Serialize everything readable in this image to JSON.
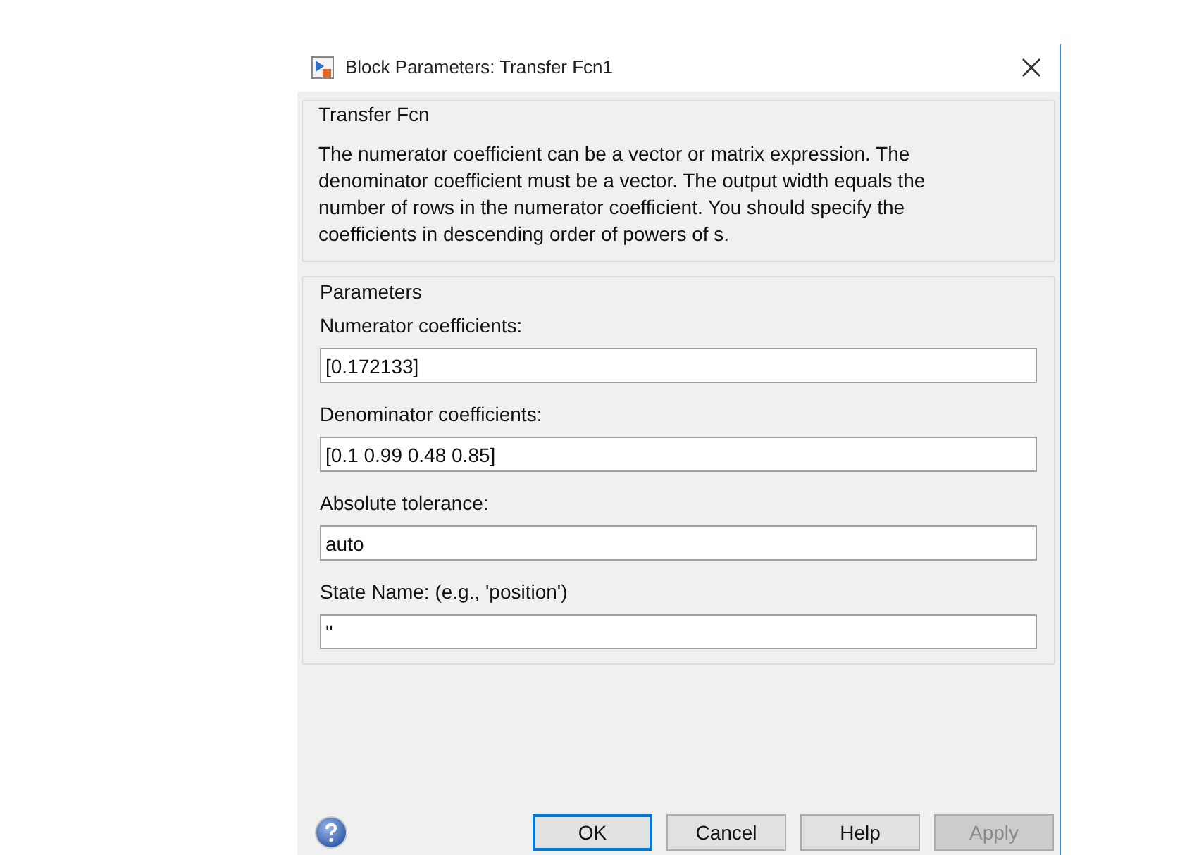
{
  "window": {
    "title": "Block Parameters: Transfer Fcn1"
  },
  "description_group": {
    "title": "Transfer Fcn",
    "text": "The numerator coefficient can be a vector or matrix expression. The denominator coefficient must be a vector. The output width equals the number of rows in the numerator coefficient. You should specify the coefficients in descending order of powers of s."
  },
  "parameters_group": {
    "title": "Parameters",
    "fields": [
      {
        "label": "Numerator coefficients:",
        "value": "[0.172133]"
      },
      {
        "label": "Denominator coefficients:",
        "value": "[0.1 0.99 0.48 0.85]"
      },
      {
        "label": "Absolute tolerance:",
        "value": "auto"
      },
      {
        "label": "State Name: (e.g., 'position')",
        "value": "''"
      }
    ]
  },
  "buttons": [
    {
      "label": "OK",
      "default": true,
      "disabled": false
    },
    {
      "label": "Cancel",
      "default": false,
      "disabled": false
    },
    {
      "label": "Help",
      "default": false,
      "disabled": false
    },
    {
      "label": "Apply",
      "default": false,
      "disabled": true
    }
  ]
}
